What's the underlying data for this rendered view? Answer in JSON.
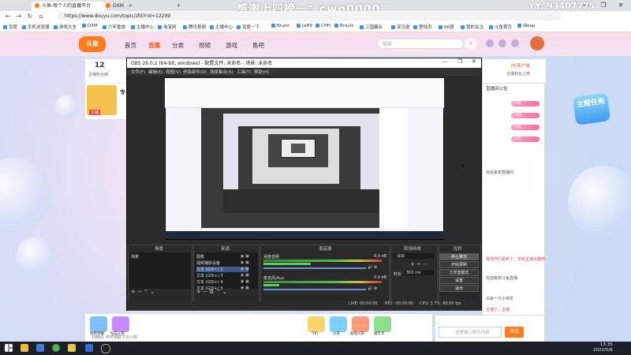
{
  "browser": {
    "tabs": [
      {
        "label": "斗鱼-每个人的直播平台",
        "active": true
      },
      {
        "label": "DXM",
        "active": false
      }
    ],
    "new_tab": "+",
    "url": "https://www.douyu.com/topic/zfd?rid=12209",
    "bookmarks": [
      "百度",
      "手机浏览器",
      "游戏大全",
      "DXM",
      "六年重炮",
      "主播中心",
      "淘宝网",
      "腾讯视频",
      "主播中心",
      "百度一下",
      "Buyer",
      "jw89",
      "CHH",
      "Braylo",
      "三国霸业",
      "亚马逊",
      "登陆页",
      "5K题",
      "我的关注",
      "斗鱼首页",
      "Weap"
    ],
    "window_controls": [
      "—",
      "❐",
      "✕"
    ]
  },
  "overlay": {
    "text": "感谢上四榜一：cwg0000",
    "right_text": "YY: 93407775"
  },
  "site": {
    "logo": "斗鱼",
    "nav": [
      "首页",
      "直播",
      "分类",
      "视频",
      "游戏",
      "鱼吧"
    ],
    "active_nav": "直播",
    "search_placeholder": "搜索",
    "room_count": "12",
    "room_count_label": "主播粉丝牌",
    "streamer_tag": "主播",
    "streamer_name": "专",
    "right_top_title": "PC客户端",
    "right_top_sub": "主播粉丝上榜",
    "task_badge": "主题任务",
    "chat_header": "直播间公告",
    "chat_badges": [
      "六级",
      "六级",
      "六级",
      "六级"
    ],
    "chat_lines": [
      "欢迎来到直播间",
      "我快你们看到了，快去主播水群吧",
      "欢迎来到斗鱼直播",
      "出来一只小绵羊",
      "主播了，主播"
    ],
    "chat_input_placeholder": "这里输入聊天内容",
    "send_label": "发送",
    "gift_labels": [
      "免费弹幕",
      "钻石火箭",
      "飞机",
      "火箭",
      "超级火箭",
      "嘉年华"
    ],
    "notice_text": "【通知】你可领取下次火箭"
  },
  "obs": {
    "title": "OBS 26.0.2 (64-bit, windows) - 配置文件: 未命名 - 场景: 未命名",
    "menu": [
      "文件(F)",
      "编辑(E)",
      "视图(V)",
      "停靠部件(D)",
      "场景集合(S)",
      "工具(T)",
      "帮助(H)"
    ],
    "docks": {
      "scenes": {
        "title": "场景",
        "items": [
          "场景"
        ]
      },
      "sources": {
        "title": "来源",
        "items": [
          "图像",
          "视频捕获设备",
          "文本 (GDI+) 2",
          "文本 (GDI+) 3",
          "文本 (GDI+) 4",
          "文本 (GDI+) 5"
        ]
      },
      "mixer": {
        "title": "混音器",
        "channels": [
          {
            "name": "桌面音频",
            "db": "0.0 dB"
          },
          {
            "name": "麦克风/Aux",
            "db": "0.0 dB"
          }
        ]
      },
      "transitions": {
        "title": "转场特效",
        "mode": "淡出",
        "duration_label": "时长",
        "duration": "300 ms"
      },
      "controls": {
        "title": "控件",
        "buttons": [
          "停止推流",
          "开始录制",
          "工作室模式",
          "设置",
          "退出"
        ]
      }
    },
    "status": {
      "live": "LIVE: 00:00:00",
      "rec": "REC: 00:00:00",
      "cpu": "CPU: 3.7%, 60.00 fps"
    }
  },
  "taskbar": {
    "time": "13:35",
    "date": "2022/5/6"
  }
}
